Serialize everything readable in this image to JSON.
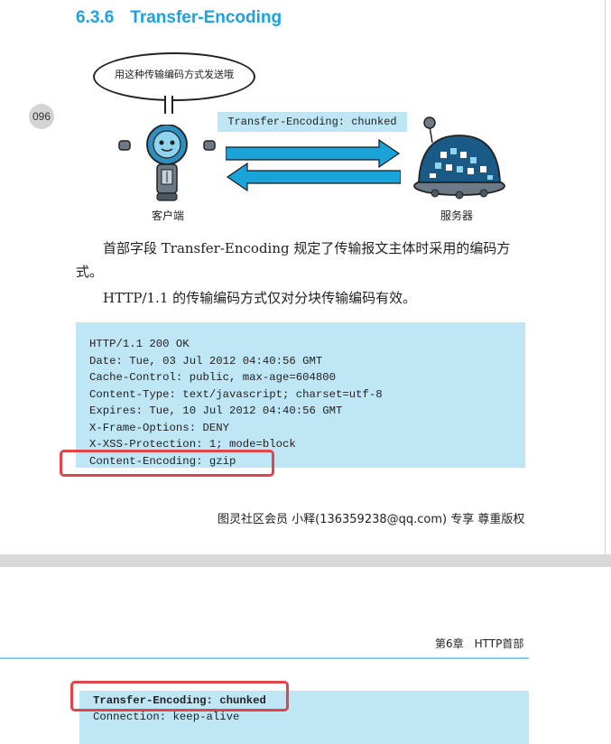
{
  "section": {
    "number": "6.3.6",
    "title": "Transfer-Encoding"
  },
  "page_number": "096",
  "figure": {
    "speech_bubble": "用这种传输编码方式发送哦",
    "header_tag": "Transfer-Encoding: chunked",
    "client_label": "客户端",
    "server_label": "服务器",
    "colors": {
      "accent": "#1aa3e0",
      "arrow": "#1aa3d9",
      "code_bg": "#bfe6f4",
      "highlight": "#e0454b"
    }
  },
  "paragraphs": {
    "p1": "首部字段 Transfer-Encoding 规定了传输报文主体时采用的编码方式。",
    "p2": "HTTP/1.1 的传输编码方式仅对分块传输编码有效。"
  },
  "code_block": {
    "lines": [
      "HTTP/1.1 200 OK",
      "Date: Tue, 03 Jul 2012 04:40:56 GMT",
      "Cache-Control: public, max-age=604800",
      "Content-Type: text/javascript; charset=utf-8",
      "Expires: Tue, 10 Jul 2012 04:40:56 GMT",
      "X-Frame-Options: DENY",
      "X-XSS-Protection: 1; mode=block",
      "Content-Encoding: gzip"
    ]
  },
  "watermark": "图灵社区会员 小释(136359238@qq.com) 专享 尊重版权",
  "page2": {
    "chapter_header": "第6章　HTTP首部",
    "code_lines": [
      "Transfer-Encoding: chunked",
      "Connection: keep-alive"
    ]
  }
}
